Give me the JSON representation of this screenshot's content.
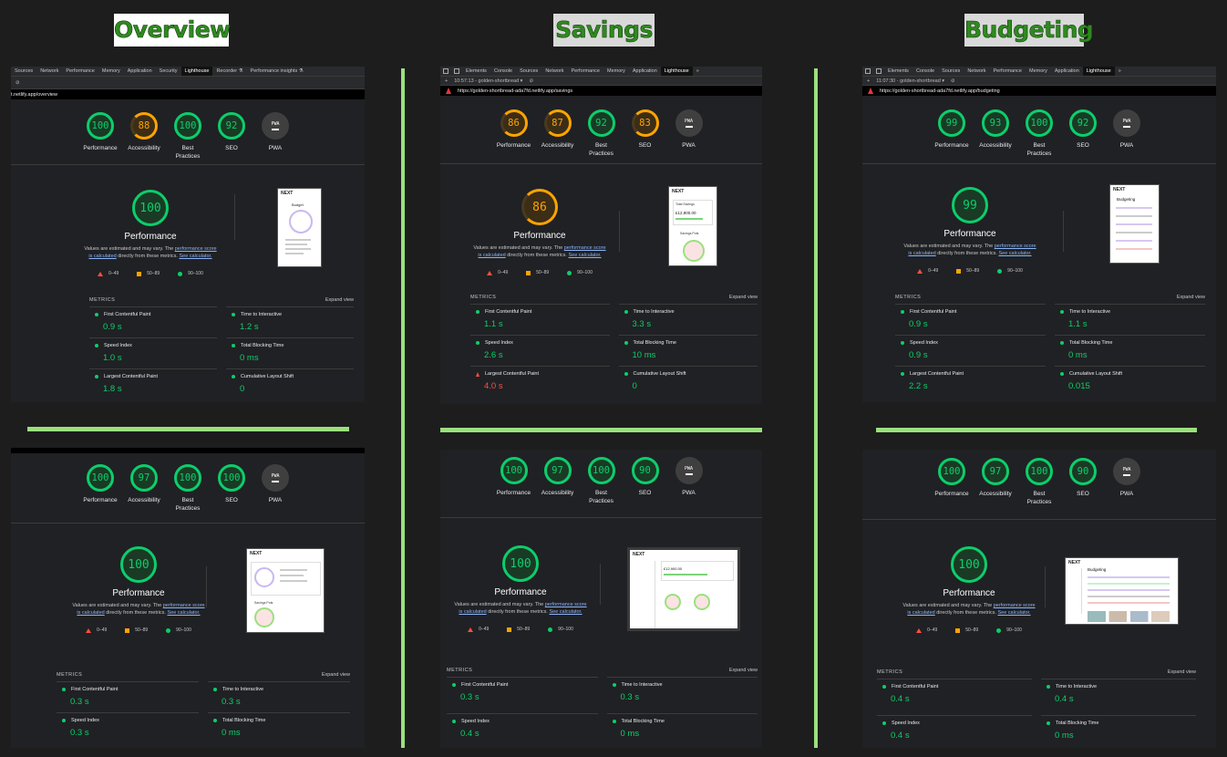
{
  "columns": {
    "overview": {
      "title": "Overview"
    },
    "savings": {
      "title": "Savings"
    },
    "budgeting": {
      "title": "Budgeting"
    }
  },
  "devtools": {
    "overview_tabs": [
      "Sources",
      "Network",
      "Performance",
      "Memory",
      "Application",
      "Security",
      "Lighthouse",
      "Recorder ⚗",
      "Performance insights ⚗"
    ],
    "tabs": [
      "Elements",
      "Console",
      "Sources",
      "Network",
      "Performance",
      "Memory",
      "Application",
      "Lighthouse",
      "»"
    ],
    "savings_time": "10:57:13 - golden-shortbread ▾",
    "budgeting_time": "11:07:30 - golden-shortbread ▾",
    "overview_url": "t.netlify.app/overview",
    "savings_url": "https://golden-shortbread-ada7fd.netlify.app/savings",
    "budgeting_url": "https://golden-shortbread-ada7fd.netlify.app/budgeting"
  },
  "labels": {
    "performance": "Performance",
    "accessibility": "Accessibility",
    "best": "Best",
    "practices": "Practices",
    "seo": "SEO",
    "pwa": "PWA",
    "desc_prefix": "Values are estimated and may vary. The ",
    "desc_link1": "performance score",
    "desc_mid": "is calculated",
    "desc_mid2": " directly from these metrics. ",
    "desc_link2": "See calculator.",
    "leg_bad": "0–49",
    "leg_avg": "50–89",
    "leg_good": "90–100",
    "metrics": "METRICS",
    "expand": "Expand view",
    "fcp": "First Contentful Paint",
    "tti": "Time to Interactive",
    "si": "Speed Index",
    "tbt": "Total Blocking Time",
    "lcp": "Largest Contentful Paint",
    "cls": "Cumulative Layout Shift",
    "next": "NEXT"
  },
  "panels": {
    "overview_mobile": {
      "scores": {
        "performance": "100",
        "accessibility": "88",
        "best_practices": "100",
        "seo": "92"
      },
      "fcp": "0.9 s",
      "tti": "1.2 s",
      "si": "1.0 s",
      "tbt": "0 ms",
      "lcp": "1.8 s",
      "cls": "0"
    },
    "savings_mobile": {
      "scores": {
        "performance": "86",
        "accessibility": "87",
        "best_practices": "92",
        "seo": "83"
      },
      "fcp": "1.1 s",
      "tti": "3.3 s",
      "si": "2.6 s",
      "tbt": "10 ms",
      "lcp": "4.0 s",
      "cls": "0"
    },
    "budgeting_mobile": {
      "scores": {
        "performance": "99",
        "accessibility": "93",
        "best_practices": "100",
        "seo": "92"
      },
      "fcp": "0.9 s",
      "tti": "1.1 s",
      "si": "0.9 s",
      "tbt": "0 ms",
      "lcp": "2.2 s",
      "cls": "0.015"
    },
    "overview_desktop": {
      "scores": {
        "performance": "100",
        "accessibility": "97",
        "best_practices": "100",
        "seo": "100"
      },
      "fcp": "0.3 s",
      "tti": "0.3 s",
      "si": "0.3 s",
      "tbt": "0 ms"
    },
    "savings_desktop": {
      "scores": {
        "performance": "100",
        "accessibility": "97",
        "best_practices": "100",
        "seo": "90"
      },
      "fcp": "0.3 s",
      "tti": "0.3 s",
      "si": "0.4 s",
      "tbt": "0 ms"
    },
    "budgeting_desktop": {
      "scores": {
        "performance": "100",
        "accessibility": "97",
        "best_practices": "100",
        "seo": "90"
      },
      "fcp": "0.4 s",
      "tti": "0.4 s",
      "si": "0.4 s",
      "tbt": "0 ms"
    }
  },
  "thumbnails": {
    "overview_mobile_heading": "Budget",
    "savings_mobile_total": "Total Savings",
    "savings_mobile_amount": "£12,900.00",
    "savings_mobile_pots": "Savings Pots",
    "budgeting_heading": "Budgeting",
    "overview_desktop_pots": "Savings Pots",
    "savings_desktop_amount": "£12,900.00"
  },
  "colors": {
    "good": "#0cce6b",
    "average": "#ffa400",
    "poor": "#ff4e42",
    "divider": "#9be07e"
  }
}
